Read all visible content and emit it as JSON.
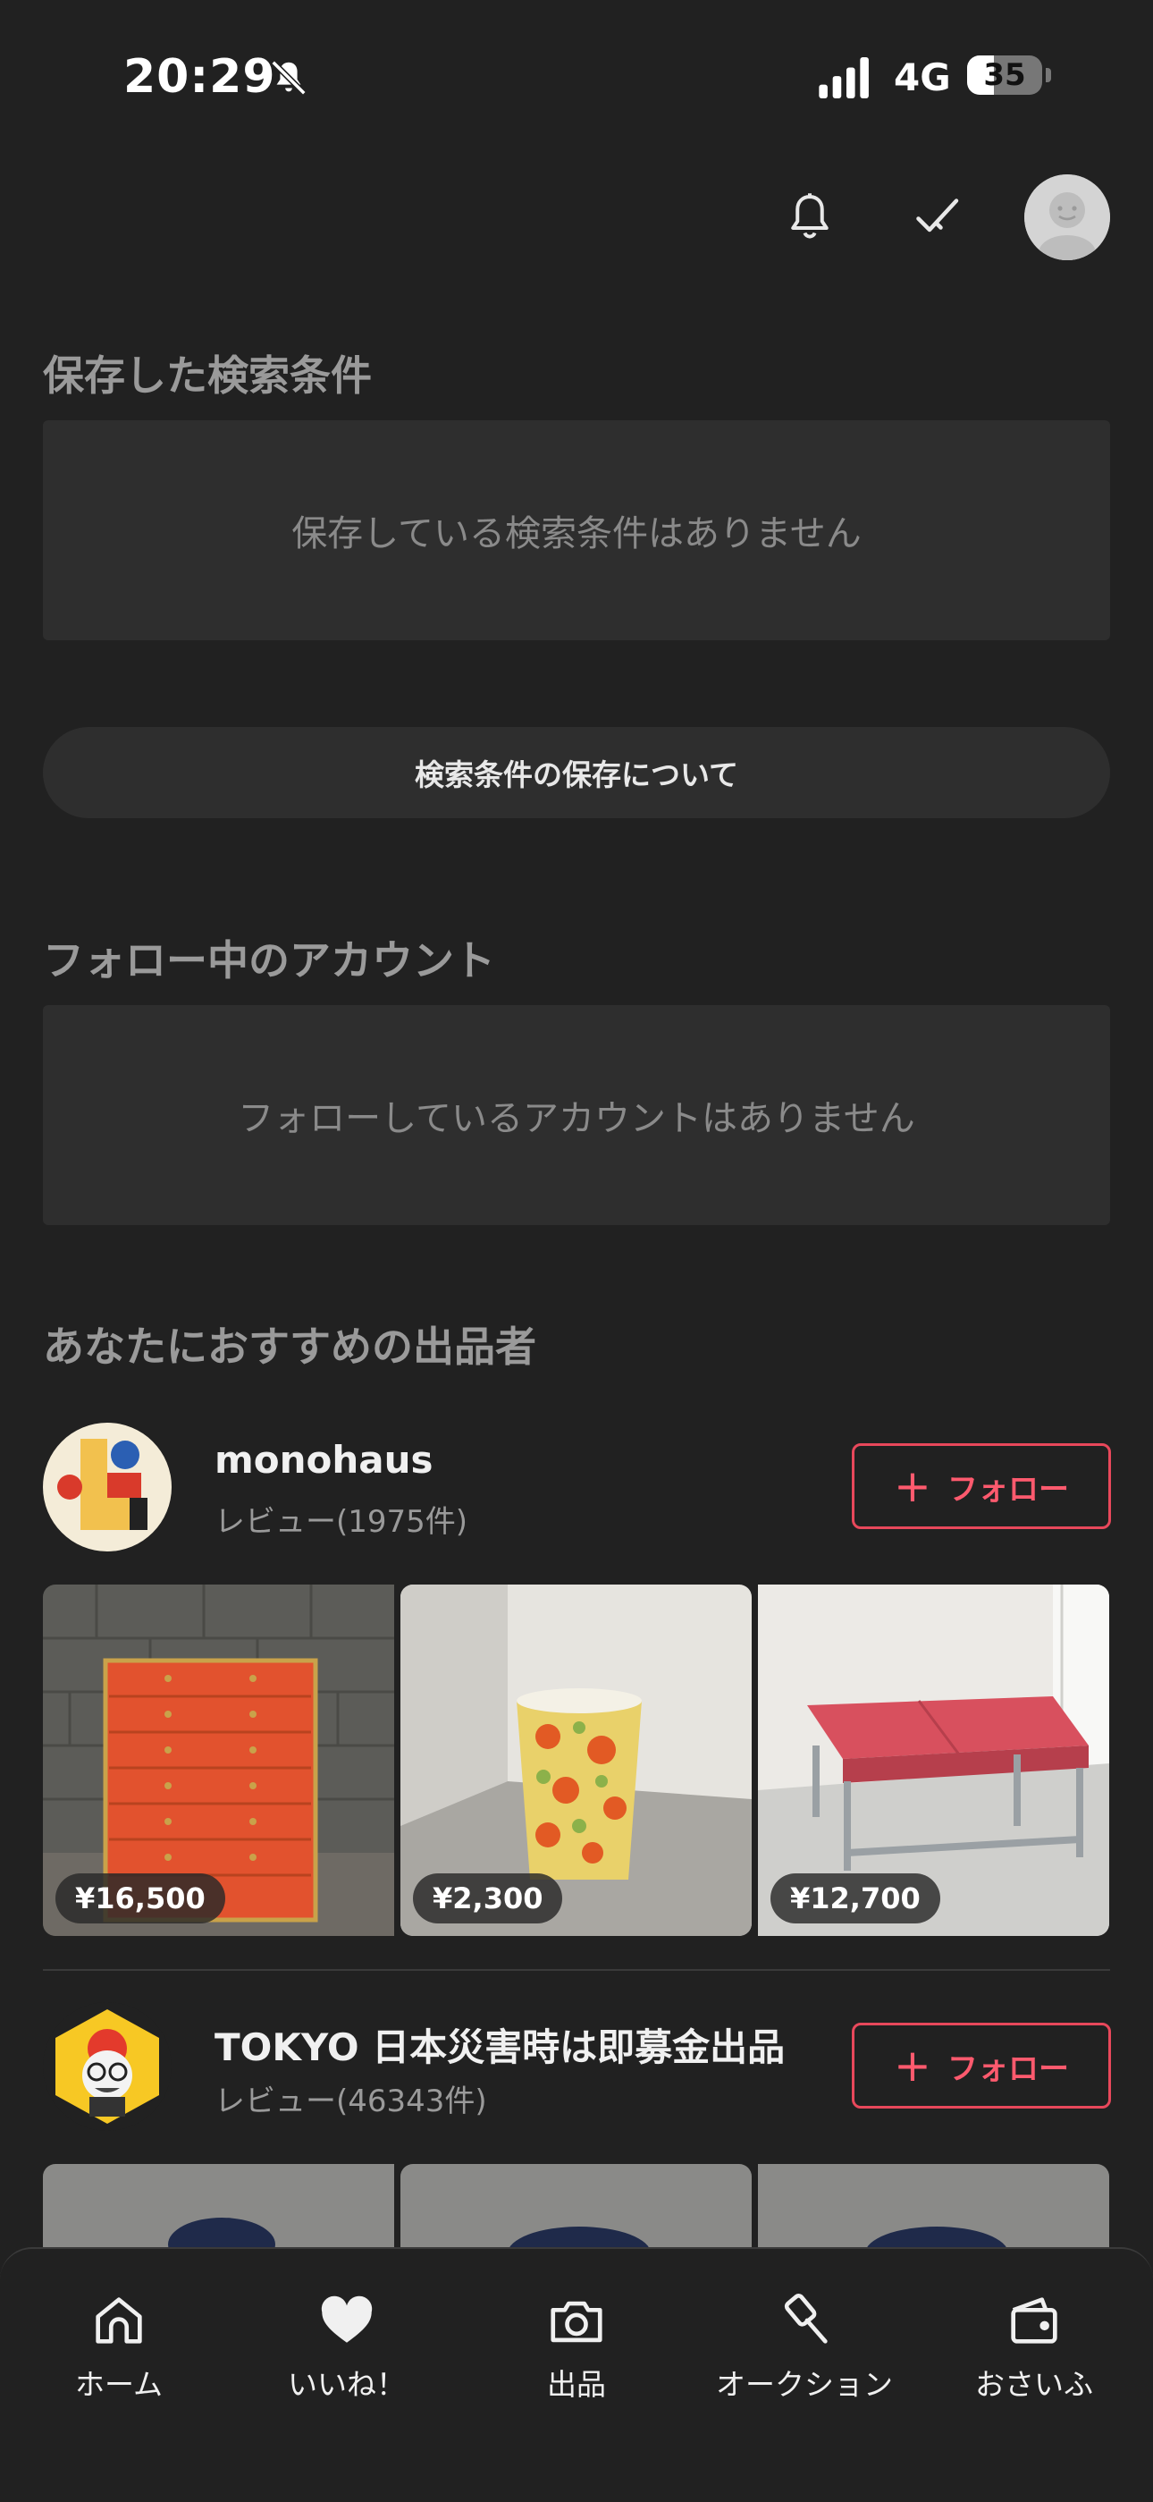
{
  "status_bar": {
    "time": "20:29",
    "network": "4G",
    "battery": "35"
  },
  "saved_searches": {
    "title": "保存した検索条件",
    "empty_message": "保存している検索条件はありません",
    "about_button": "検索条件の保存について"
  },
  "following": {
    "title": "フォロー中のアカウント",
    "empty_message": "フォローしているアカウントはありません"
  },
  "recommended": {
    "title": "あなたにおすすめの出品者",
    "sellers": [
      {
        "name": "monohaus",
        "reviews": "レビュー(1975件)",
        "follow_label": "フォロー",
        "items": [
          {
            "price": "¥16,500"
          },
          {
            "price": "¥2,300"
          },
          {
            "price": "¥12,700"
          }
        ]
      },
      {
        "name": "TOKYO 日本災害時は即募金出品",
        "reviews": "レビュー(46343件)",
        "follow_label": "フォロー"
      }
    ]
  },
  "bottom_nav": {
    "home": "ホーム",
    "likes": "いいね！",
    "sell": "出品",
    "auction": "オークション",
    "wallet": "おさいふ"
  },
  "colors": {
    "accent": "#e8485b",
    "background": "#212121",
    "card": "#2e2e2e"
  }
}
